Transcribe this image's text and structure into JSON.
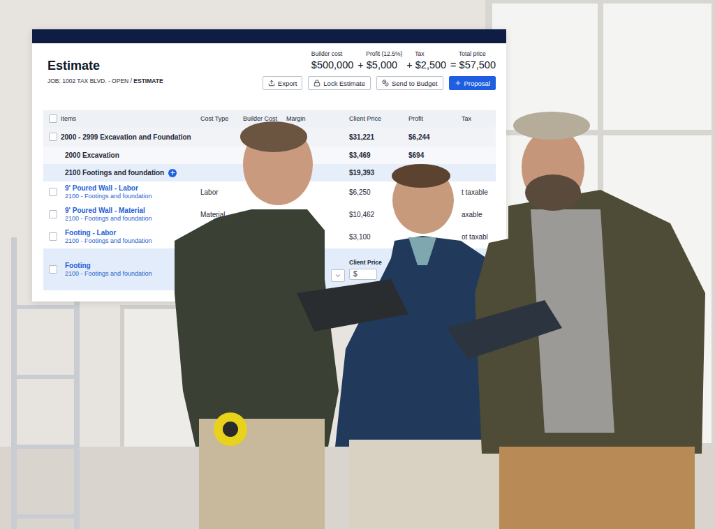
{
  "estimate": {
    "title": "Estimate",
    "breadcrumb": {
      "path": "JOB: 1002 TAX BLVD. - OPEN / ",
      "current": "ESTIMATE"
    },
    "summary": [
      {
        "label": "Builder cost",
        "operator": "",
        "value": "$500,000"
      },
      {
        "label": "Profit (12.5%)",
        "operator": "+",
        "value": "$5,000"
      },
      {
        "label": "Tax",
        "operator": "+",
        "value": "$2,500"
      },
      {
        "label": "Total price",
        "operator": "=",
        "value": "$57,500"
      }
    ],
    "actions": [
      {
        "label": "Export",
        "kind": "export"
      },
      {
        "label": "Lock Estimate",
        "kind": "lock"
      },
      {
        "label": "Send to Budget",
        "kind": "budget"
      },
      {
        "label": "Proposal",
        "kind": "primary"
      }
    ],
    "table": {
      "select_all": {
        "checked": false
      },
      "columns": [
        "Items",
        "Cost Type",
        "Builder Cost",
        "Margin",
        "Client Price",
        "Profit",
        "Tax"
      ],
      "rows": [
        {
          "kind": "group",
          "name": "2000 - 2999 Excavation and Foundation",
          "checked": false,
          "client_price": "$31,221",
          "profit": "$6,244"
        },
        {
          "kind": "subgroup",
          "name": "2000 Excavation",
          "highlighted": false,
          "expandable": false,
          "client_price": "$3,469",
          "profit": "$694"
        },
        {
          "kind": "subgroup",
          "name": "2100 Footings and foundation",
          "highlighted": true,
          "expandable": true,
          "client_price": "$19,393"
        },
        {
          "kind": "item",
          "name": "9' Poured Wall - Labor",
          "category": "2100 - Footings and foundation",
          "checked": false,
          "cost_type": "Labor",
          "client_price": "$6,250",
          "tax": "t taxable"
        },
        {
          "kind": "item",
          "name": "9' Poured Wall - Material",
          "category": "2100 - Footings and foundation",
          "checked": false,
          "cost_type": "Material",
          "client_price": "$10,462",
          "tax": "axable"
        },
        {
          "kind": "item",
          "name": "Footing - Labor",
          "category": "2100 - Footings and foundation",
          "checked": false,
          "client_price": "$3,100",
          "tax": "ot taxabl"
        },
        {
          "kind": "editing",
          "name": "Footing",
          "category": "2100 - Footings and foundation",
          "checked": false,
          "field_label": "Client Price",
          "field_value": "$"
        }
      ]
    }
  }
}
